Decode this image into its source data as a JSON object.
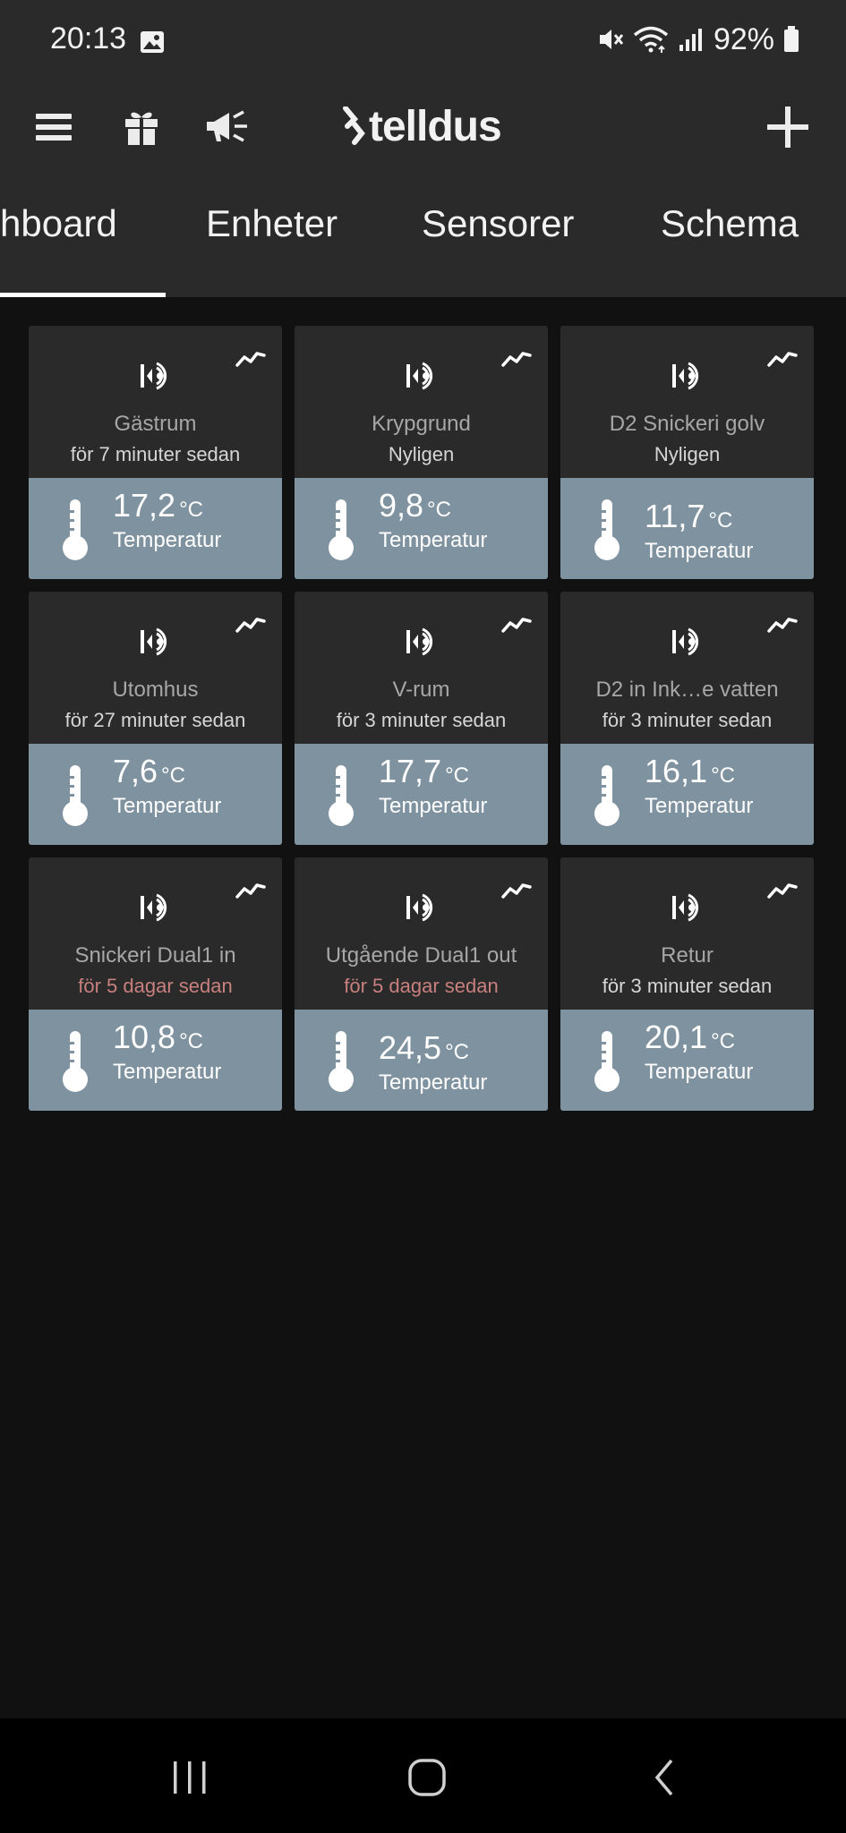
{
  "status_bar": {
    "time": "20:13",
    "battery": "92%",
    "icons": [
      "gallery-icon",
      "mute-icon",
      "wifi-icon",
      "signal-icon",
      "battery-icon"
    ]
  },
  "app_bar": {
    "logo_text": "telldus",
    "icons": [
      "menu-icon",
      "gift-icon",
      "megaphone-icon",
      "plus-icon"
    ]
  },
  "tabs": [
    {
      "label": "hboard",
      "selected": true
    },
    {
      "label": "Enheter",
      "selected": false
    },
    {
      "label": "Sensorer",
      "selected": false
    },
    {
      "label": "Schema",
      "selected": false
    }
  ],
  "sensors": [
    {
      "name": "Gästrum",
      "time": "för 7 minuter sedan",
      "stale": false,
      "value": "17,2",
      "unit": "°C",
      "label": "Temperatur"
    },
    {
      "name": "Krypgrund",
      "time": "Nyligen",
      "stale": false,
      "value": "9,8",
      "unit": "°C",
      "label": "Temperatur"
    },
    {
      "name": "D2 Snickeri golv",
      "time": "Nyligen",
      "stale": false,
      "value": "11,7",
      "unit": "°C",
      "label": "Temperatur"
    },
    {
      "name": "Utomhus",
      "time": "för 27 minuter sedan",
      "stale": false,
      "value": "7,6",
      "unit": "°C",
      "label": "Temperatur"
    },
    {
      "name": "V-rum",
      "time": "för 3 minuter sedan",
      "stale": false,
      "value": "17,7",
      "unit": "°C",
      "label": "Temperatur"
    },
    {
      "name": "D2 in Ink…e vatten",
      "time": "för 3 minuter sedan",
      "stale": false,
      "value": "16,1",
      "unit": "°C",
      "label": "Temperatur"
    },
    {
      "name": "Snickeri Dual1 in",
      "time": "för 5 dagar sedan",
      "stale": true,
      "value": "10,8",
      "unit": "°C",
      "label": "Temperatur"
    },
    {
      "name": "Utgående Dual1 out",
      "time": "för 5 dagar sedan",
      "stale": true,
      "value": "24,5",
      "unit": "°C",
      "label": "Temperatur"
    },
    {
      "name": "Retur",
      "time": "för 3 minuter sedan",
      "stale": false,
      "value": "20,1",
      "unit": "°C",
      "label": "Temperatur"
    }
  ],
  "colors": {
    "background": "#111111",
    "bar": "#2a2a2a",
    "card_value_bg": "#7f929f",
    "stale_text": "#c7807e"
  },
  "nav_bar": {
    "icons": [
      "recent-apps-icon",
      "home-icon",
      "back-icon"
    ]
  }
}
